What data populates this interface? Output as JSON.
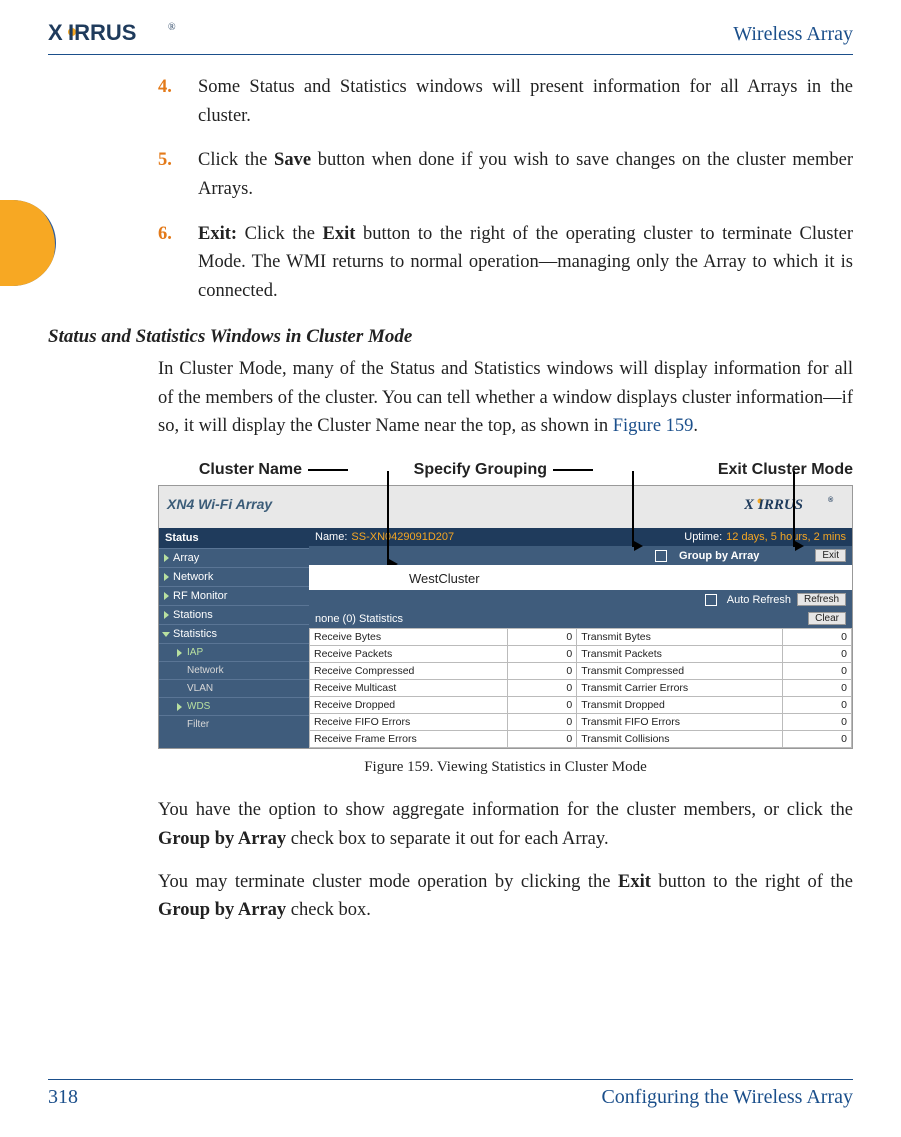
{
  "header": {
    "brand": "XIRRUS",
    "title": "Wireless Array"
  },
  "steps": {
    "n4": "4.",
    "t4": "Some Status and Statistics windows will present information for all Arrays in the cluster.",
    "n5": "5.",
    "t5a": "Click the ",
    "t5b": "Save",
    "t5c": " button when done if you wish to save changes on the cluster member Arrays.",
    "n6": "6.",
    "t6a": "Exit:",
    "t6b": " Click the ",
    "t6c": "Exit",
    "t6d": " button to the right of the operating cluster to terminate Cluster Mode. The WMI returns to normal operation—managing only the Array to which it is connected."
  },
  "sub": {
    "heading": "Status and Statistics Windows in Cluster Mode",
    "p1": "In Cluster Mode, many of the Status and Statistics windows will display information for all of the members of the cluster. You can tell whether a window displays cluster information—if so, it will display the Cluster Name near the top, as shown in ",
    "figref": "Figure 159",
    "p1b": "."
  },
  "callouts": {
    "a": "Cluster Name",
    "b": "Specify Grouping",
    "c": "Exit Cluster Mode"
  },
  "shot": {
    "product": "XN4 Wi-Fi Array",
    "brand": "XIRRUS",
    "nameLabel": "Name:",
    "nameValue": "SS-XN0429091D207",
    "uptimeLabel": "Uptime:",
    "uptimeValue": "12 days, 5 hours, 2 mins",
    "groupBy": "Group by Array",
    "exit": "Exit",
    "cluster": "WestCluster",
    "autoRefresh": "Auto Refresh",
    "refresh": "Refresh",
    "statsTitle": "none (0) Statistics",
    "clear": "Clear",
    "side": {
      "status": "Status",
      "array": "Array",
      "network": "Network",
      "rf": "RF Monitor",
      "stations": "Stations",
      "statistics": "Statistics",
      "iap": "IAP",
      "net2": "Network",
      "vlan": "VLAN",
      "wds": "WDS",
      "filter": "Filter"
    },
    "rows": [
      {
        "l": "Receive Bytes",
        "lv": "0",
        "r": "Transmit Bytes",
        "rv": "0"
      },
      {
        "l": "Receive Packets",
        "lv": "0",
        "r": "Transmit Packets",
        "rv": "0"
      },
      {
        "l": "Receive Compressed",
        "lv": "0",
        "r": "Transmit Compressed",
        "rv": "0"
      },
      {
        "l": "Receive Multicast",
        "lv": "0",
        "r": "Transmit Carrier Errors",
        "rv": "0"
      },
      {
        "l": "Receive Dropped",
        "lv": "0",
        "r": "Transmit Dropped",
        "rv": "0"
      },
      {
        "l": "Receive FIFO Errors",
        "lv": "0",
        "r": "Transmit FIFO Errors",
        "rv": "0"
      },
      {
        "l": "Receive Frame Errors",
        "lv": "0",
        "r": "Transmit Collisions",
        "rv": "0"
      }
    ]
  },
  "figcaption": "Figure 159. Viewing Statistics in Cluster Mode",
  "after": {
    "p1a": "You have the option to show aggregate information for the cluster members, or click the ",
    "p1b": "Group by Array",
    "p1c": " check box to separate it out for each Array.",
    "p2a": "You may terminate cluster mode operation by clicking the ",
    "p2b": "Exit",
    "p2c": " button to the right of the ",
    "p2d": "Group by Array",
    "p2e": " check box."
  },
  "footer": {
    "page": "318",
    "section": "Configuring the Wireless Array"
  }
}
